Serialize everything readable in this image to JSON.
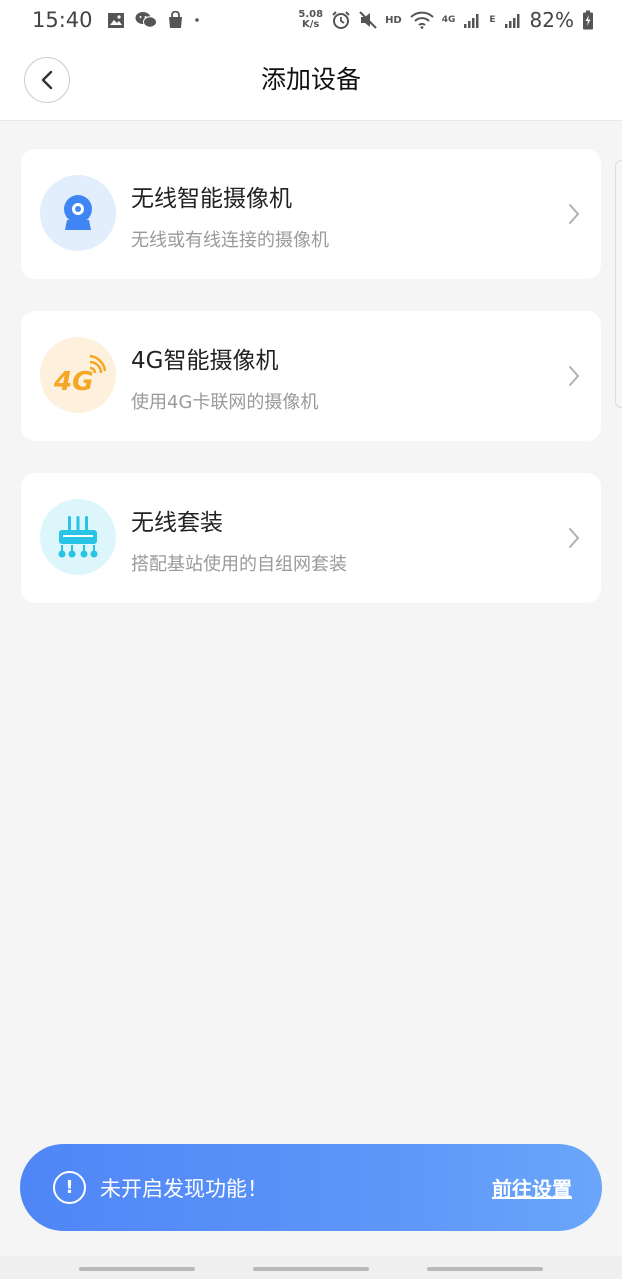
{
  "status_bar": {
    "time": "15:40",
    "speed_value": "5.08",
    "speed_unit": "K/s",
    "hd": "HD",
    "network": "4G",
    "network2": "E",
    "battery": "82%"
  },
  "header": {
    "title": "添加设备"
  },
  "devices": [
    {
      "title": "无线智能摄像机",
      "desc": "无线或有线连接的摄像机",
      "icon": "wifi-camera-icon",
      "icon_bg": "#e3eefd",
      "icon_color": "#3f86f4"
    },
    {
      "title": "4G智能摄像机",
      "desc": "使用4G卡联网的摄像机",
      "icon": "4g-camera-icon",
      "icon_label": "4G",
      "icon_bg": "#fdf0dc",
      "icon_color": "#f5a623"
    },
    {
      "title": "无线套装",
      "desc": "搭配基站使用的自组网套装",
      "icon": "router-kit-icon",
      "icon_bg": "#ddf6fb",
      "icon_color": "#27c4e6"
    }
  ],
  "banner": {
    "alert_symbol": "!",
    "message": "未开启发现功能！",
    "link": "前往设置"
  },
  "colors": {
    "accent": "#4f86f7",
    "background": "#f5f5f5"
  }
}
